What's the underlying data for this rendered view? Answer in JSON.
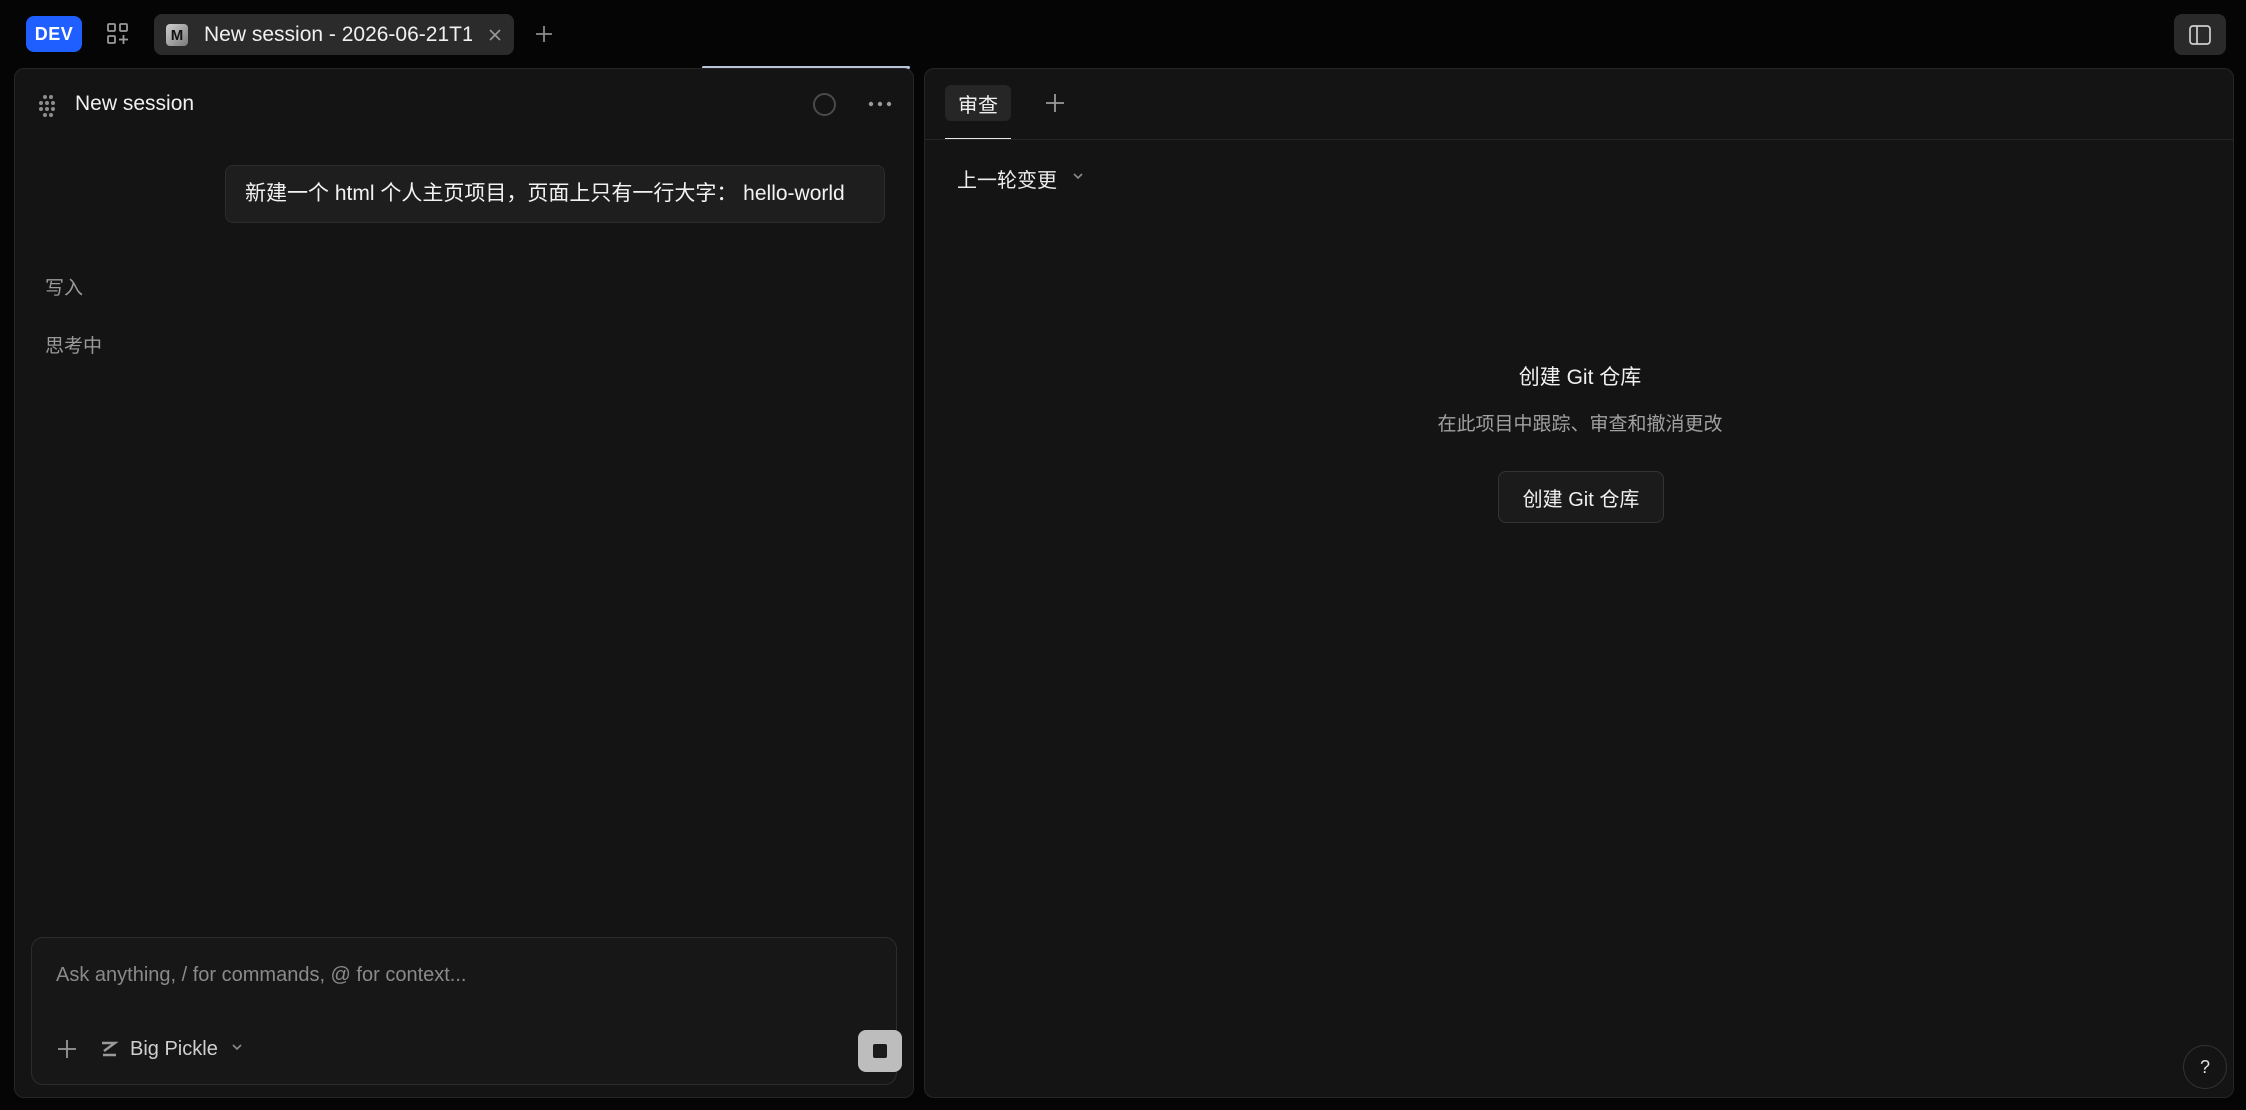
{
  "topbar": {
    "dev_badge": "DEV",
    "apps_icon": "grid-plus-icon",
    "tab": {
      "logo": "M",
      "title": "New session - 2026-06-21T1",
      "close_icon": "close-icon"
    },
    "new_tab_icon": "plus-icon",
    "panel_toggle_icon": "sidebar-toggle-icon",
    "accent_color": "#1f5eff"
  },
  "left_pane": {
    "session_icon": "dot-grid-icon",
    "title": "New session",
    "status_icon": "circle-icon",
    "more_icon": "ellipsis-icon",
    "user_message": "新建一个 html 个人主页项目，页面上只有一行大字： hello-world",
    "steps": [
      "写入",
      "思考中"
    ],
    "composer": {
      "placeholder": "Ask anything, / for commands, @ for context...",
      "value": "",
      "add_icon": "plus-icon",
      "model_icon": "model-z-icon",
      "model_name": "Big Pickle",
      "model_chevron": "chevron-down-icon",
      "stop_icon": "stop-icon"
    }
  },
  "right_pane": {
    "tabs": [
      {
        "label": "审查"
      }
    ],
    "add_tab_icon": "plus-icon",
    "scope": {
      "label": "上一轮变更",
      "chevron": "chevron-down-icon"
    },
    "empty_state": {
      "title": "创建 Git 仓库",
      "description": "在此项目中跟踪、审查和撤消更改",
      "button_label": "创建 Git 仓库"
    },
    "help_label": "?"
  }
}
